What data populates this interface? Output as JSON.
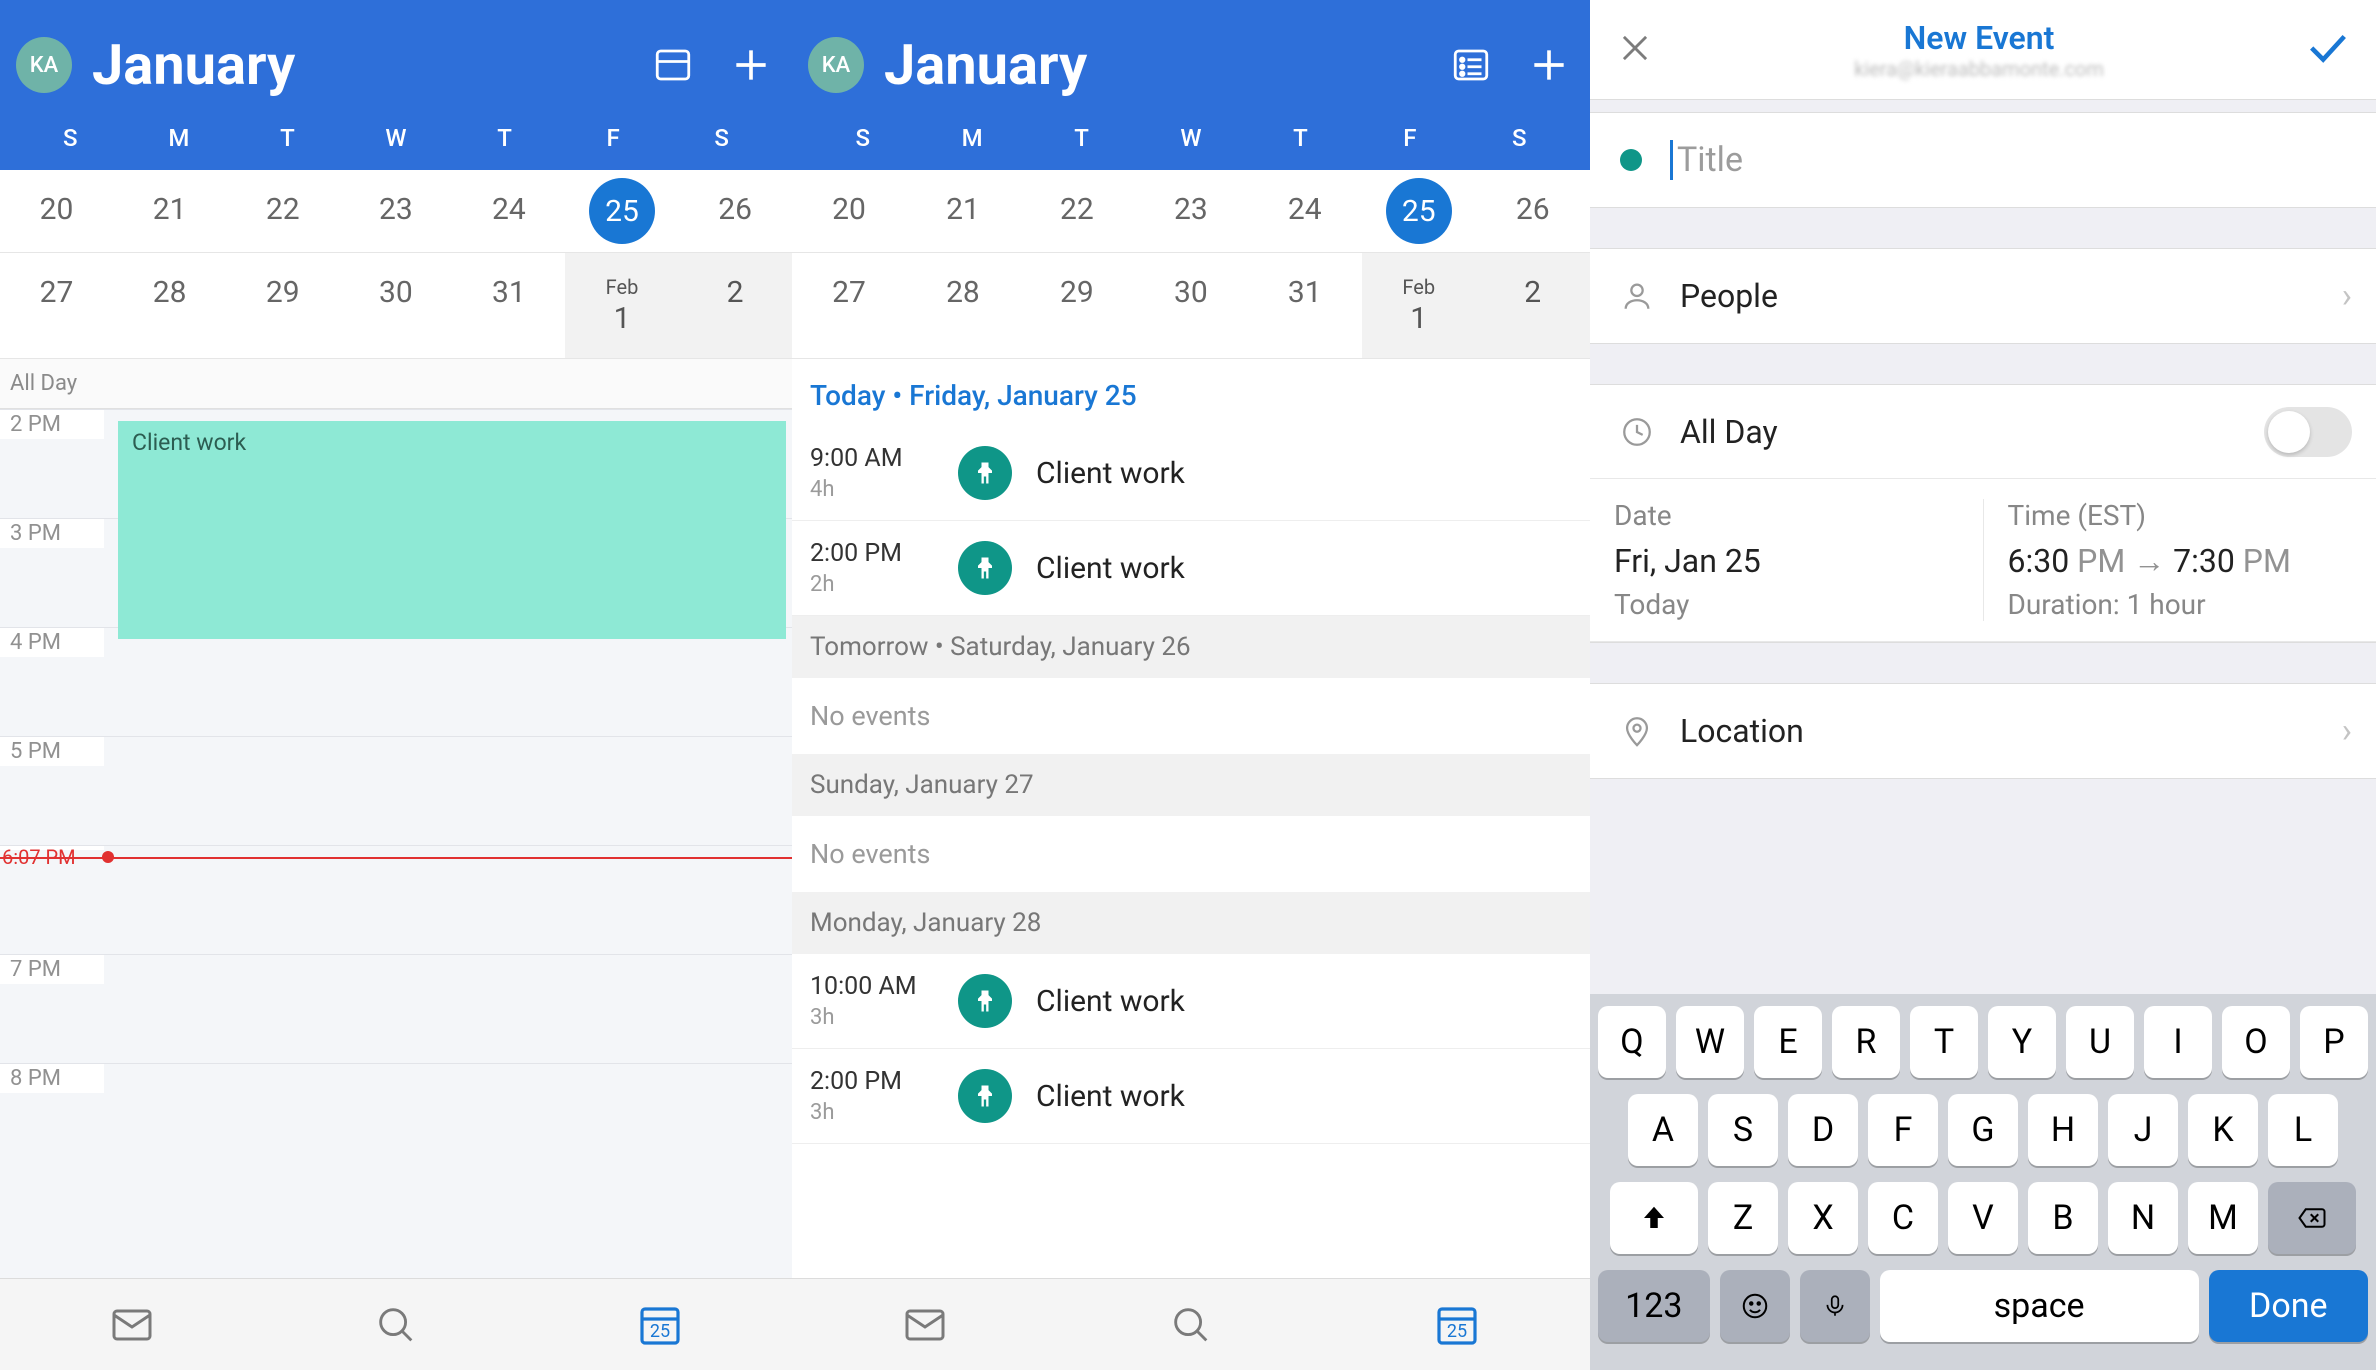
{
  "avatar_initials": "KA",
  "month_title": "January",
  "weekdays": [
    "S",
    "M",
    "T",
    "W",
    "T",
    "F",
    "S"
  ],
  "week1": [
    {
      "num": "20"
    },
    {
      "num": "21"
    },
    {
      "num": "22"
    },
    {
      "num": "23"
    },
    {
      "num": "24"
    },
    {
      "num": "25",
      "selected": true
    },
    {
      "num": "26"
    }
  ],
  "week2": [
    {
      "num": "27"
    },
    {
      "num": "28"
    },
    {
      "num": "29"
    },
    {
      "num": "30"
    },
    {
      "num": "31"
    },
    {
      "num": "1",
      "month": "Feb",
      "nextm": true
    },
    {
      "num": "2",
      "nextm": true
    }
  ],
  "panel1": {
    "all_day_label": "All Day",
    "hours": [
      "2 PM",
      "3 PM",
      "4 PM",
      "5 PM",
      "",
      "7 PM",
      "8 PM"
    ],
    "event_label": "Client work",
    "now_label": "6:07 PM"
  },
  "panel2": {
    "sections": [
      {
        "header": "Today • Friday, January 25",
        "today": true,
        "events": [
          {
            "time": "9:00 AM",
            "dur": "4h",
            "title": "Client work"
          },
          {
            "time": "2:00 PM",
            "dur": "2h",
            "title": "Client work"
          }
        ]
      },
      {
        "header": "Tomorrow • Saturday, January 26",
        "noevents": "No events"
      },
      {
        "header": "Sunday, January 27",
        "noevents": "No events"
      },
      {
        "header": "Monday, January 28",
        "events": [
          {
            "time": "10:00 AM",
            "dur": "3h",
            "title": "Client work"
          },
          {
            "time": "2:00 PM",
            "dur": "3h",
            "title": "Client work"
          }
        ]
      }
    ]
  },
  "tabbar_calendar_num": "25",
  "panel3": {
    "header_title": "New Event",
    "header_sub": "kiera@kieraabbamonte.com",
    "title_placeholder": "Title",
    "people_label": "People",
    "allday_label": "All Day",
    "date_label": "Date",
    "date_value": "Fri, Jan 25",
    "date_sub": "Today",
    "time_label": "Time (EST)",
    "time_start": "6:30",
    "time_start_ampm": "PM",
    "time_arrow": "→",
    "time_end": "7:30",
    "time_end_ampm": "PM",
    "duration": "Duration: 1 hour",
    "location_label": "Location"
  },
  "keyboard": {
    "row1": [
      "Q",
      "W",
      "E",
      "R",
      "T",
      "Y",
      "U",
      "I",
      "O",
      "P"
    ],
    "row2": [
      "A",
      "S",
      "D",
      "F",
      "G",
      "H",
      "J",
      "K",
      "L"
    ],
    "row3": [
      "Z",
      "X",
      "C",
      "V",
      "B",
      "N",
      "M"
    ],
    "key_123": "123",
    "key_space": "space",
    "key_done": "Done"
  }
}
